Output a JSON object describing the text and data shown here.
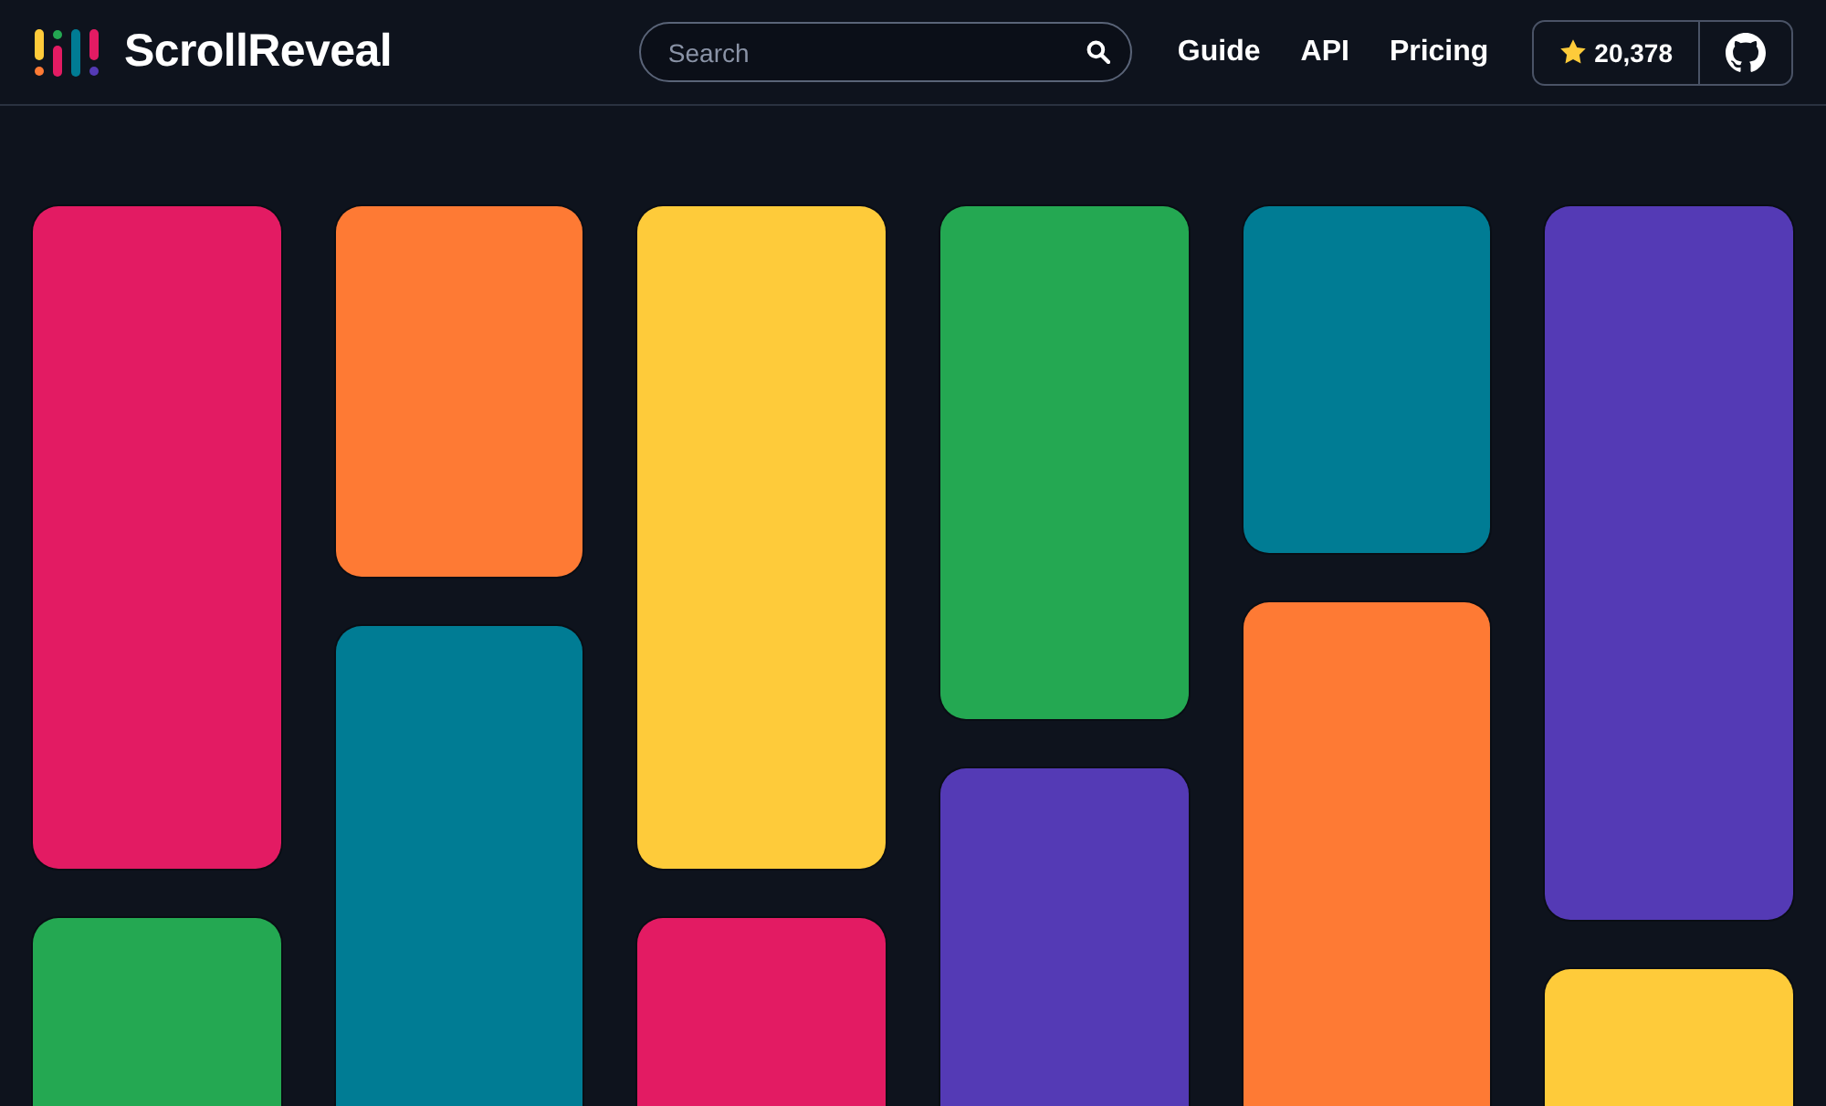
{
  "header": {
    "brand": "ScrollReveal",
    "search": {
      "placeholder": "Search"
    },
    "nav": [
      "Guide",
      "API",
      "Pricing"
    ],
    "stars": "20,378"
  },
  "columns": [
    [
      {
        "kind": "tall",
        "color": "#e31b63"
      },
      {
        "kind": "tall",
        "color": "#24a852"
      }
    ],
    [
      {
        "kind": "short",
        "color": "#fe7a34"
      },
      {
        "kind": "tall",
        "color": "#007c94"
      }
    ],
    [
      {
        "kind": "tall",
        "color": "#fecb3a"
      },
      {
        "kind": "tall",
        "color": "#e31b63"
      }
    ],
    [
      {
        "kind": "medium",
        "color": "#24a852"
      },
      {
        "kind": "tall",
        "color": "#543ab5"
      }
    ],
    [
      {
        "kind": "small",
        "color": "#007c94"
      },
      {
        "kind": "tall",
        "color": "#fe7a34"
      }
    ],
    [
      {
        "kind": "xtall",
        "color": "#543ab5"
      },
      {
        "kind": "tall",
        "color": "#fecb3a"
      }
    ]
  ]
}
